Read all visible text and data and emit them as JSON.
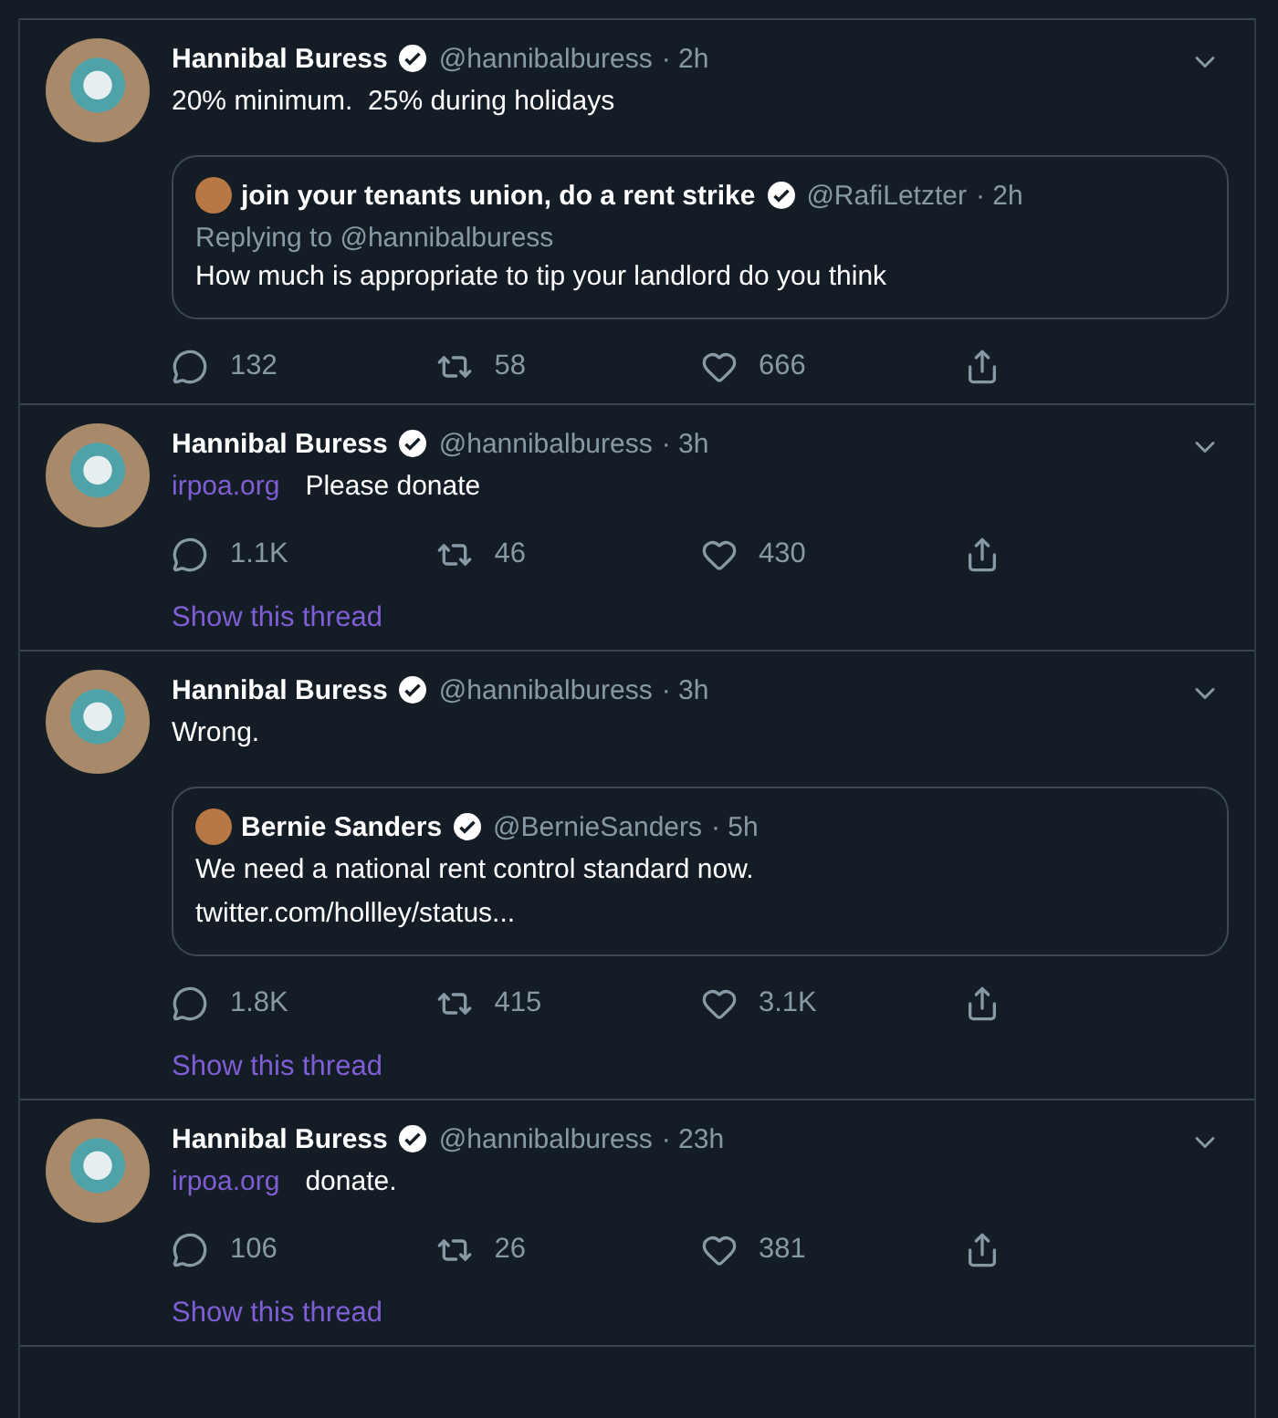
{
  "tweets": [
    {
      "name": "Hannibal Buress",
      "verified": true,
      "handle": "@hannibalburess",
      "time": "· 2h",
      "text": "20% minimum.  25% during holidays",
      "quote": {
        "name": "join your tenants union, do a rent strike",
        "verified": true,
        "handle": "@RafiLetzter",
        "time": "· 2h",
        "replying_to": "Replying to @hannibalburess",
        "text": "How much is appropriate to tip your landlord do you think"
      },
      "replies": "132",
      "retweets": "58",
      "likes": "666"
    },
    {
      "name": "Hannibal Buress",
      "verified": true,
      "handle": "@hannibalburess",
      "time": "· 3h",
      "link": "irpoa.org",
      "text": "Please donate",
      "replies": "1.1K",
      "retweets": "46",
      "likes": "430",
      "thread_link": "Show this thread"
    },
    {
      "name": "Hannibal Buress",
      "verified": true,
      "handle": "@hannibalburess",
      "time": "· 3h",
      "text": "Wrong.",
      "quote": {
        "name": "Bernie Sanders",
        "verified": true,
        "handle": "@BernieSanders",
        "time": "· 5h",
        "text": "We need a national rent control standard now.",
        "link": "twitter.com/hollley/status..."
      },
      "replies": "1.8K",
      "retweets": "415",
      "likes": "3.1K",
      "thread_link": "Show this thread"
    },
    {
      "name": "Hannibal Buress",
      "verified": true,
      "handle": "@hannibalburess",
      "time": "· 23h",
      "link": "irpoa.org",
      "text": "donate.",
      "replies": "106",
      "retweets": "26",
      "likes": "381",
      "thread_link": "Show this thread"
    }
  ]
}
